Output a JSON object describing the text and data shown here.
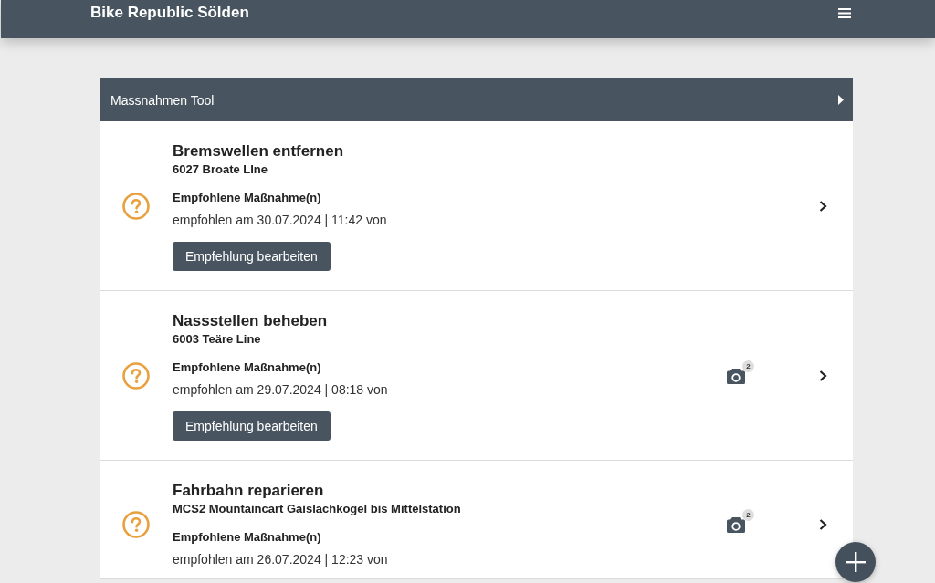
{
  "header": {
    "title": "Bike Republic Sölden"
  },
  "panel": {
    "title": "Massnahmen Tool"
  },
  "items": [
    {
      "title": "Bremswellen entfernen",
      "location": "6027 Broate LIne",
      "label": "Empfohlene Maßnahme(n)",
      "meta": "empfohlen am 30.07.2024 | 11:42 von",
      "button": "Empfehlung bearbeiten"
    },
    {
      "title": "Nassstellen beheben",
      "location": "6003 Teäre Line",
      "label": "Empfohlene Maßnahme(n)",
      "meta": "empfohlen am 29.07.2024 | 08:18 von",
      "button": "Empfehlung bearbeiten",
      "photo_count": "2"
    },
    {
      "title": "Fahrbahn reparieren",
      "location": "MCS2 Mountaincart Gaislachkogel bis Mittelstation",
      "label": "Empfohlene Maßnahme(n)",
      "meta": "empfohlen am 26.07.2024 | 12:23 von",
      "photo_count": "2"
    }
  ]
}
